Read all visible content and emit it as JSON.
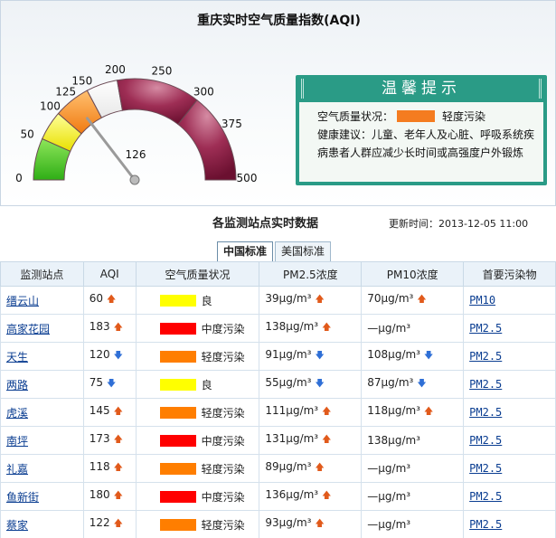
{
  "header": {
    "title": "重庆实时空气质量指数(AQI)"
  },
  "gauge": {
    "value": 126,
    "value_label": "126",
    "ticks": [
      "0",
      "50",
      "100",
      "125",
      "150",
      "200",
      "250",
      "300",
      "375",
      "500"
    ]
  },
  "tips": {
    "title": "温馨提示",
    "status_label": "空气质量状况：",
    "status_color": "#f47c20",
    "status_text": "轻度污染",
    "advice": "健康建议：儿童、老年人及心脏、呼吸系统疾病患者人群应减少长时间或高强度户外锻炼"
  },
  "section": {
    "title": "各监测站点实时数据",
    "update_time": "更新时间：2013-12-05 11:00"
  },
  "tabs": [
    {
      "label": "中国标准",
      "active": true
    },
    {
      "label": "美国标准",
      "active": false
    }
  ],
  "table": {
    "headers": [
      "监测站点",
      "AQI",
      "空气质量状况",
      "PM2.5浓度",
      "PM10浓度",
      "首要污染物"
    ],
    "rows": [
      {
        "site": "缙云山",
        "aqi": "60",
        "aqi_trend": "up",
        "color": "#ffff00",
        "level": "良",
        "pm25": "39μg/m³",
        "pm25_trend": "up",
        "pm10": "70μg/m³",
        "pm10_trend": "up",
        "pollutant": "PM10"
      },
      {
        "site": "高家花园",
        "aqi": "183",
        "aqi_trend": "up",
        "color": "#ff0000",
        "level": "中度污染",
        "pm25": "138μg/m³",
        "pm25_trend": "up",
        "pm10": "—μg/m³",
        "pm10_trend": "",
        "pollutant": "PM2.5"
      },
      {
        "site": "天生",
        "aqi": "120",
        "aqi_trend": "down",
        "color": "#ff7e00",
        "level": "轻度污染",
        "pm25": "91μg/m³",
        "pm25_trend": "down",
        "pm10": "108μg/m³",
        "pm10_trend": "down",
        "pollutant": "PM2.5"
      },
      {
        "site": "两路",
        "aqi": "75",
        "aqi_trend": "down",
        "color": "#ffff00",
        "level": "良",
        "pm25": "55μg/m³",
        "pm25_trend": "down",
        "pm10": "87μg/m³",
        "pm10_trend": "down",
        "pollutant": "PM2.5"
      },
      {
        "site": "虎溪",
        "aqi": "145",
        "aqi_trend": "up",
        "color": "#ff7e00",
        "level": "轻度污染",
        "pm25": "111μg/m³",
        "pm25_trend": "up",
        "pm10": "118μg/m³",
        "pm10_trend": "up",
        "pollutant": "PM2.5"
      },
      {
        "site": "南坪",
        "aqi": "173",
        "aqi_trend": "up",
        "color": "#ff0000",
        "level": "中度污染",
        "pm25": "131μg/m³",
        "pm25_trend": "up",
        "pm10": "138μg/m³",
        "pm10_trend": "",
        "pollutant": "PM2.5"
      },
      {
        "site": "礼嘉",
        "aqi": "118",
        "aqi_trend": "up",
        "color": "#ff7e00",
        "level": "轻度污染",
        "pm25": "89μg/m³",
        "pm25_trend": "up",
        "pm10": "—μg/m³",
        "pm10_trend": "",
        "pollutant": "PM2.5"
      },
      {
        "site": "鱼新街",
        "aqi": "180",
        "aqi_trend": "up",
        "color": "#ff0000",
        "level": "中度污染",
        "pm25": "136μg/m³",
        "pm25_trend": "up",
        "pm10": "—μg/m³",
        "pm10_trend": "",
        "pollutant": "PM2.5"
      },
      {
        "site": "蔡家",
        "aqi": "122",
        "aqi_trend": "up",
        "color": "#ff7e00",
        "level": "轻度污染",
        "pm25": "93μg/m³",
        "pm25_trend": "up",
        "pm10": "—μg/m³",
        "pm10_trend": "",
        "pollutant": "PM2.5"
      }
    ]
  }
}
